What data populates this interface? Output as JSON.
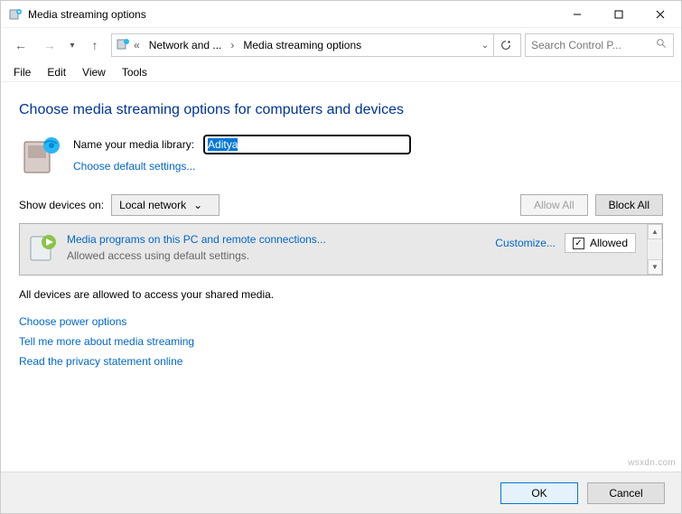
{
  "window": {
    "title": "Media streaming options"
  },
  "nav": {
    "breadcrumb_root": "Network and ...",
    "breadcrumb_leaf": "Media streaming options",
    "search_placeholder": "Search Control P..."
  },
  "menubar": [
    "File",
    "Edit",
    "View",
    "Tools"
  ],
  "page": {
    "heading": "Choose media streaming options for computers and devices",
    "library_label": "Name your media library:",
    "library_value": "Aditya",
    "choose_default": "Choose default settings...",
    "show_devices_label": "Show devices on:",
    "show_devices_value": "Local network",
    "allow_all": "Allow All",
    "block_all": "Block All",
    "device": {
      "title": "Media programs on this PC and remote connections...",
      "subtitle": "Allowed access using default settings.",
      "customize": "Customize...",
      "allowed": "Allowed"
    },
    "status": "All devices are allowed to access your shared media.",
    "links": [
      "Choose power options",
      "Tell me more about media streaming",
      "Read the privacy statement online"
    ]
  },
  "footer": {
    "ok": "OK",
    "cancel": "Cancel"
  },
  "watermark": "wsxdn.com"
}
